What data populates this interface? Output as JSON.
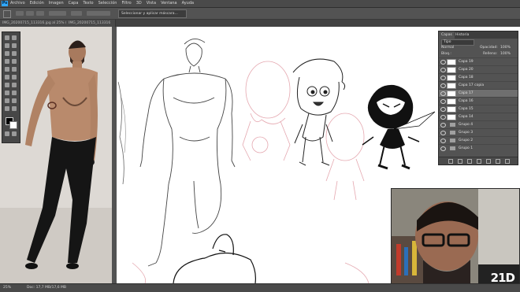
{
  "menubar": {
    "app_icon": "Ps",
    "items": [
      "Archivo",
      "Edición",
      "Imagen",
      "Capa",
      "Texto",
      "Selección",
      "Filtro",
      "3D",
      "Vista",
      "Ventana",
      "Ayuda"
    ]
  },
  "options_bar": {
    "select_subject_button": "Seleccionar y aplicar máscara..."
  },
  "document_tabs": [
    "IMG_20200715_113316.jpg al 25% (RGB/8)",
    "IMG_20200715_113316"
  ],
  "layers_panel": {
    "tabs": [
      "Capas",
      "Historia"
    ],
    "kind_filter": "Tipo",
    "blend_mode": "Normal",
    "opacity_label": "Opacidad:",
    "opacity_value": "100%",
    "lock_label": "Bloq.:",
    "fill_label": "Relleno:",
    "fill_value": "100%",
    "layers": [
      {
        "name": "Capa 19",
        "type": "layer"
      },
      {
        "name": "Capa 20",
        "type": "layer"
      },
      {
        "name": "Capa 18",
        "type": "layer"
      },
      {
        "name": "Capa 17 copia",
        "type": "layer"
      },
      {
        "name": "Capa 17",
        "type": "layer",
        "selected": true
      },
      {
        "name": "Capa 16",
        "type": "layer"
      },
      {
        "name": "Capa 15",
        "type": "layer"
      },
      {
        "name": "Capa 14",
        "type": "layer"
      },
      {
        "name": "Grupo 4",
        "type": "group"
      },
      {
        "name": "Grupo 3",
        "type": "group"
      },
      {
        "name": "Grupo 2",
        "type": "group"
      },
      {
        "name": "Grupo 1",
        "type": "group"
      }
    ]
  },
  "status": {
    "zoom": "25%",
    "doc_size": "Doc: 17,7 MB/17,6 MB"
  },
  "watermark": "21D",
  "colors": {
    "accent": "#31a8ff",
    "panel": "#535353",
    "canvas": "#ffffff"
  }
}
